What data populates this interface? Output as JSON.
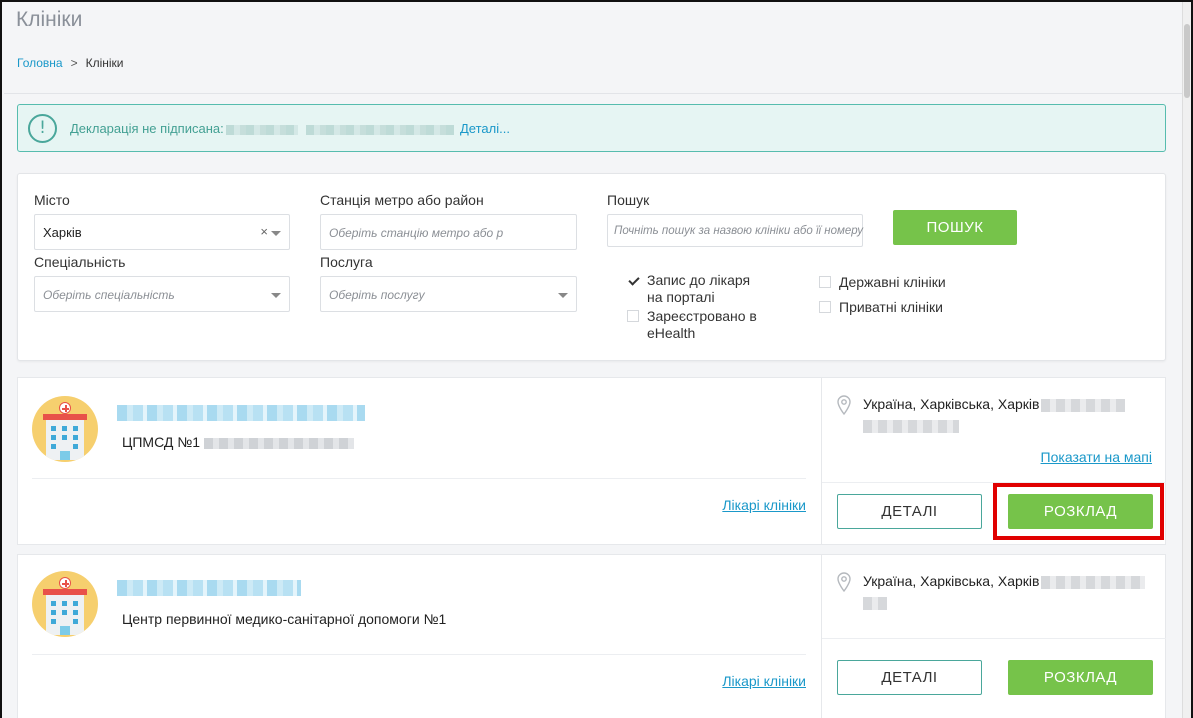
{
  "page": {
    "title": "Клініки"
  },
  "breadcrumb": {
    "home": "Головна",
    "separator": ">",
    "current": "Клініки"
  },
  "alert": {
    "icon": "info-exclamation-icon",
    "text": "Декларація не підписана:",
    "link": "Деталі..."
  },
  "filters": {
    "city_label": "Місто",
    "city_value": "Харків",
    "city_clear": "×",
    "metro_label": "Станція метро або район",
    "metro_placeholder": "Оберіть станцію метро або р",
    "search_label": "Пошук",
    "search_placeholder": "Почніть пошук за назвою клініки або її номеру",
    "search_button": "ПОШУК",
    "specialty_label": "Спеціальність",
    "specialty_placeholder": "Оберіть спеціальність",
    "service_label": "Послуга",
    "service_placeholder": "Оберіть послугу",
    "checkboxes": [
      {
        "label_line1": "Запис до лікаря",
        "label_line2": "на порталі",
        "checked": true
      },
      {
        "label_line1": "Зареєстровано в",
        "label_line2": "eHealth",
        "checked": false
      },
      {
        "label_line1": "Державні клініки",
        "label_line2": "",
        "checked": false
      },
      {
        "label_line1": "Приватні клініки",
        "label_line2": "",
        "checked": false
      }
    ]
  },
  "clinics": [
    {
      "subtitle": "ЦПМСД №1",
      "doctors_link": "Лікарі клініки",
      "address": "Україна, Харківська, Харків",
      "map_link": "Показати на мапі",
      "details_button": "ДЕТАЛІ",
      "schedule_button": "РОЗКЛАД"
    },
    {
      "subtitle": "Центр первинної медико-санітарної допомоги №1",
      "doctors_link": "Лікарі клініки",
      "address": "Україна, Харківська, Харків",
      "details_button": "ДЕТАЛІ",
      "schedule_button": "РОЗКЛАД"
    }
  ],
  "colors": {
    "accent_green": "#76c34a",
    "link_blue": "#1a98c9",
    "teal": "#4aa79b",
    "highlight_red": "#e00000"
  }
}
